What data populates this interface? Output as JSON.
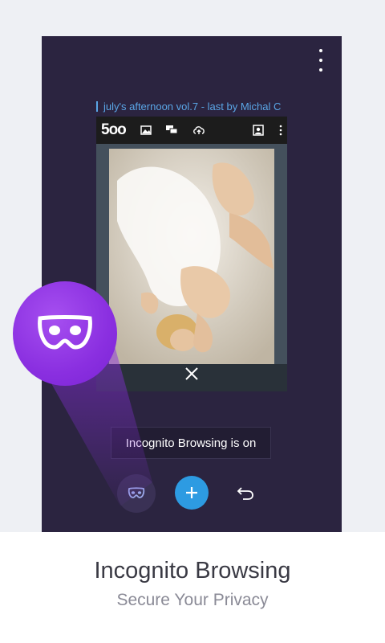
{
  "tab": {
    "title": "july's afternoon vol.7 - last by Michal C"
  },
  "site": {
    "logo_text": "5oo"
  },
  "toast": {
    "text": "Incognito Browsing is on"
  },
  "footer": {
    "title": "Incognito Browsing",
    "subtitle": "Secure Your Privacy"
  },
  "icons": {
    "menu": "more-vertical-icon",
    "incognito": "incognito-mask-icon",
    "add": "plus-icon",
    "undo": "undo-icon",
    "close": "close-icon",
    "toolbar": [
      "image-icon",
      "comments-icon",
      "upload-icon",
      "profile-icon",
      "more-icon"
    ]
  },
  "colors": {
    "background": "#eef0f4",
    "phone_bg": "#2b2440",
    "accent_blue": "#2d9be2",
    "accent_purple": "#8a2fe0",
    "tab_title": "#5aa6e6"
  }
}
